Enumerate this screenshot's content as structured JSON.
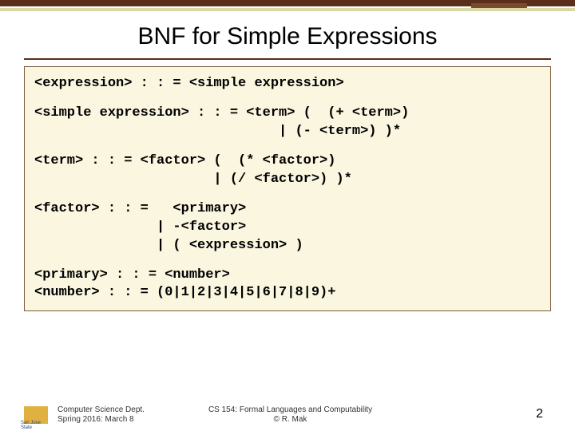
{
  "title": "BNF for Simple Expressions",
  "rules": {
    "r1": "<expression> : : = <simple expression>",
    "r2": "<simple expression> : : = <term> (  (+ <term>)\n                              | (- <term>) )*",
    "r3": "<term> : : = <factor> (  (* <factor>)\n                      | (/ <factor>) )*",
    "r4": "<factor> : : =   <primary>\n               | -<factor>\n               | ( <expression> )",
    "r5": "<primary> : : = <number>\n<number> : : = (0|1|2|3|4|5|6|7|8|9)+"
  },
  "footer": {
    "dept": "Computer Science Dept.",
    "date": "Spring 2016: March 8",
    "course": "CS 154: Formal Languages and Computability",
    "author": "© R. Mak",
    "uni": "San Jose State",
    "page": "2"
  }
}
